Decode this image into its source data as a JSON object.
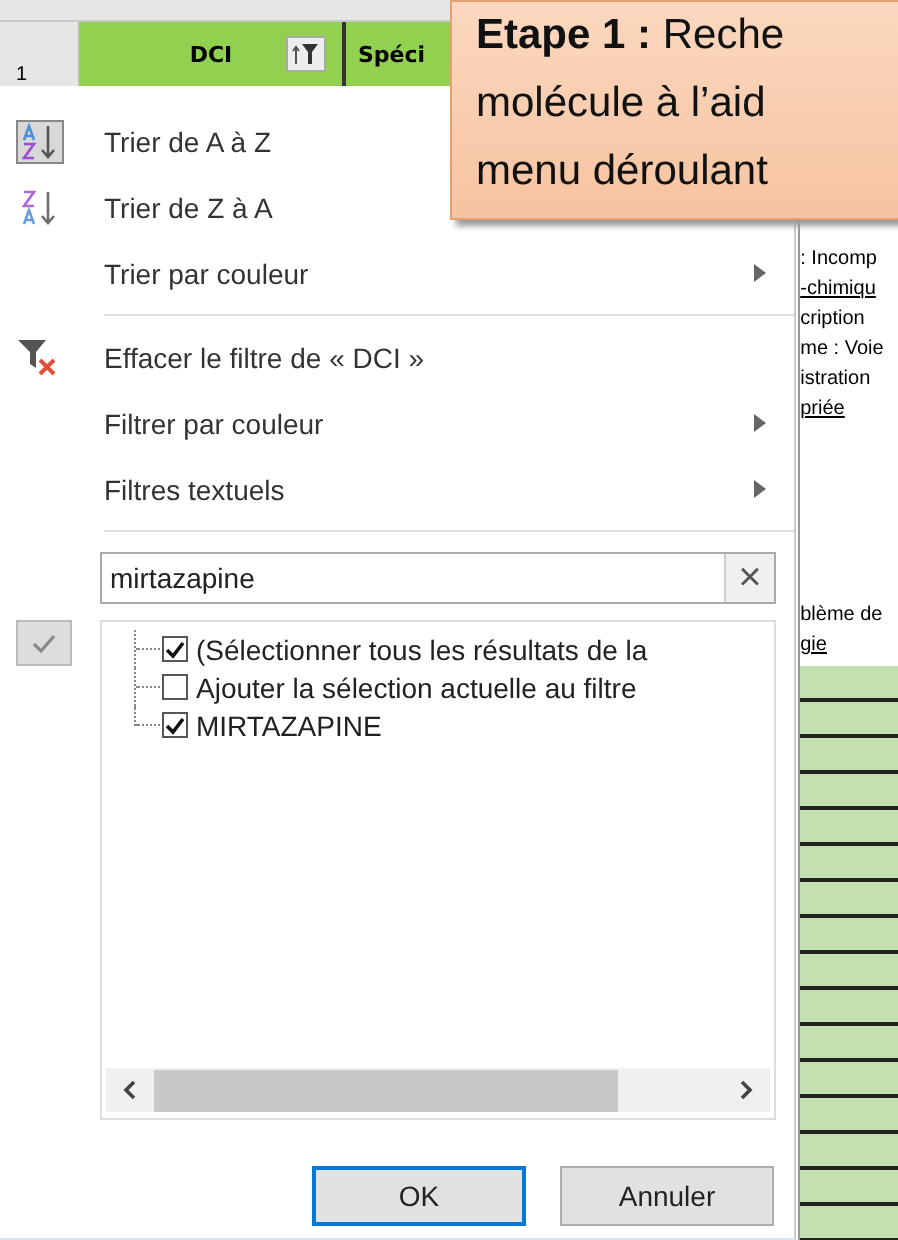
{
  "sheet": {
    "row_number": "1",
    "columns": [
      {
        "label": "DCI",
        "filter_active": true
      },
      {
        "label": "Spéci",
        "filter_active": false
      }
    ],
    "cell_texts": [
      {
        "text": ": Incomp",
        "underlined": false
      },
      {
        "text": "-chimiqu",
        "underlined": true
      },
      {
        "text": "cription",
        "underlined": false
      },
      {
        "text": "me : Voie",
        "underlined": false
      },
      {
        "text": "istration",
        "underlined": false
      },
      {
        "text": "priée",
        "underlined": true
      }
    ],
    "cell_texts_lower": [
      {
        "text": "blème de",
        "underlined": false
      },
      {
        "text": "gie",
        "underlined": true
      }
    ]
  },
  "callout": {
    "lines": [
      "**Etape 1 :** Reche",
      "molécule à l’aid",
      "menu déroulant"
    ]
  },
  "menu": {
    "items": [
      {
        "kind": "sort-ascending",
        "label": "Trier de A à Z",
        "submenu": false,
        "selected": true
      },
      {
        "kind": "sort-descending",
        "label": "Trier de Z à A",
        "submenu": false,
        "selected": false
      },
      {
        "kind": "plain",
        "label": "Trier par couleur",
        "submenu": true
      },
      {
        "kind": "separator"
      },
      {
        "kind": "clear-filter",
        "label": "Effacer le filtre de « DCI »",
        "submenu": false
      },
      {
        "kind": "plain",
        "label": "Filtrer par couleur",
        "submenu": true
      },
      {
        "kind": "plain",
        "label": "Filtres textuels",
        "submenu": true
      },
      {
        "kind": "separator"
      }
    ],
    "search": {
      "value": "mirtazapine",
      "clear": "×"
    },
    "values": [
      {
        "label": "(Sélectionner tous les résultats de la",
        "checked": true
      },
      {
        "label": "Ajouter la sélection actuelle au filtre",
        "checked": false
      },
      {
        "label": "MIRTAZAPINE",
        "checked": true
      }
    ],
    "buttons": [
      {
        "label": "OK",
        "default": true
      },
      {
        "label": "Annuler",
        "default": false
      }
    ]
  }
}
